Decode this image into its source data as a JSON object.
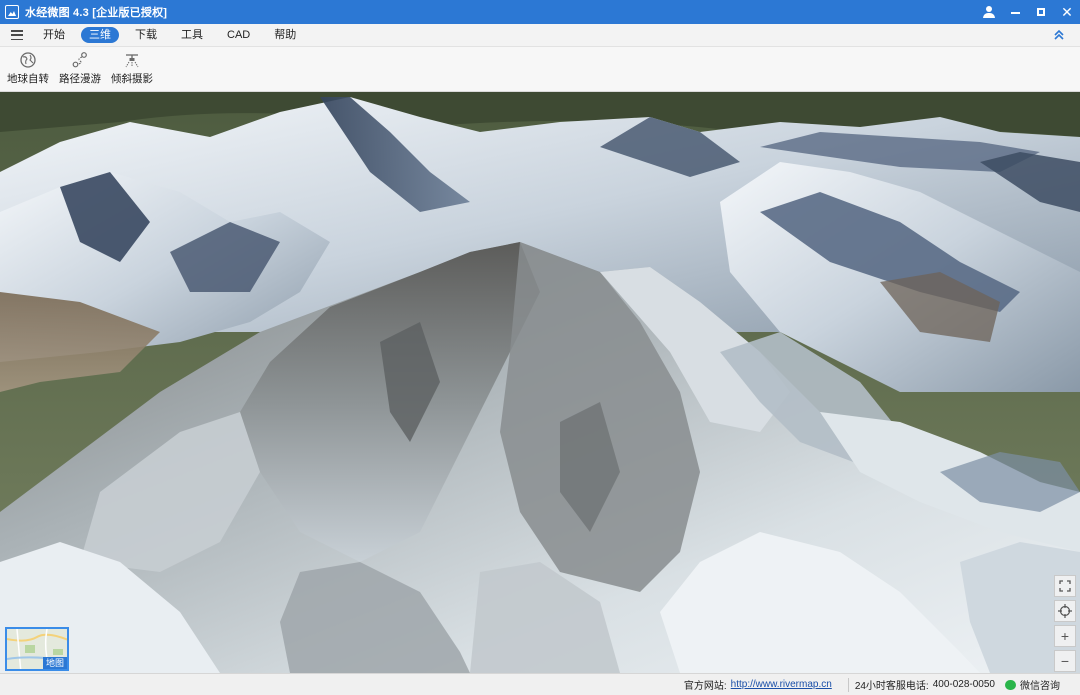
{
  "app": {
    "title": "水经微图 4.3 [企业版已授权]",
    "brand_color": "#2c78d4"
  },
  "window_controls": {
    "user_icon": "user-icon",
    "minimize_icon": "minimize-icon",
    "maximize_icon": "maximize-icon",
    "close_glyph": "✕"
  },
  "menu": {
    "tabs": [
      {
        "label": "开始",
        "active": false
      },
      {
        "label": "三维",
        "active": true
      },
      {
        "label": "下载",
        "active": false
      },
      {
        "label": "工具",
        "active": false
      },
      {
        "label": "CAD",
        "active": false
      },
      {
        "label": "帮助",
        "active": false
      }
    ]
  },
  "toolbar": {
    "items": [
      {
        "label": "地球自转",
        "icon": "globe-icon"
      },
      {
        "label": "路径漫游",
        "icon": "route-icon"
      },
      {
        "label": "倾斜摄影",
        "icon": "drone-icon"
      }
    ]
  },
  "map": {
    "minimap_label": "地图",
    "nav_glyphs": {
      "zoom_in": "+",
      "zoom_out": "−"
    }
  },
  "status": {
    "website_label": "官方网站:",
    "website_url": "http://www.rivermap.cn",
    "phone_label": "24小时客服电话:",
    "phone_number": "400-028-0050",
    "wechat_label": "微信咨询"
  }
}
